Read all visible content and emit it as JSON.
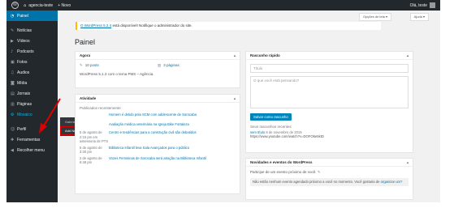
{
  "adminbar": {
    "site_name": "agencia-teste",
    "new_label": "+ Novo",
    "greeting": "Olá, teste"
  },
  "sidebar": {
    "items": [
      {
        "icon": "dashboard-icon",
        "glyph": "◔",
        "label": "Painel"
      },
      {
        "icon": "pin-icon",
        "glyph": "✎",
        "label": "Notícias"
      },
      {
        "icon": "video-icon",
        "glyph": "▶",
        "label": "Vídeos"
      },
      {
        "icon": "podcast-icon",
        "glyph": "♪",
        "label": "Podcasts"
      },
      {
        "icon": "photo-icon",
        "glyph": "▣",
        "label": "Fotos"
      },
      {
        "icon": "audio-icon",
        "glyph": "♫",
        "label": "Audios"
      },
      {
        "icon": "media-icon",
        "glyph": "◙",
        "label": "Mídia"
      },
      {
        "icon": "journal-icon",
        "glyph": "▤",
        "label": "Jornais"
      },
      {
        "icon": "pages-icon",
        "glyph": "▥",
        "label": "Páginas"
      },
      {
        "icon": "gallery-icon",
        "glyph": "⚙",
        "label": "Mosaico"
      },
      {
        "icon": "profile-icon",
        "glyph": "☺",
        "label": "Perfil"
      },
      {
        "icon": "tools-icon",
        "glyph": "✚",
        "label": "Ferramentas"
      },
      {
        "icon": "collapse-icon",
        "glyph": "◀",
        "label": "Recolher menu"
      }
    ],
    "submenu": [
      "Galerias",
      "Add New"
    ]
  },
  "header": {
    "screen_options": "Opções de tela ▾",
    "help": "Ajuda ▾"
  },
  "notice": {
    "link": "O WordPress 5.2.4",
    "text": " está disponível! Notifique o administrador do site."
  },
  "page_title": "Painel",
  "glance": {
    "title": "Agora",
    "posts": "10 posts",
    "pages": "3 páginas",
    "version": "WordPress 5.1.3 com o tema PMS – Agência."
  },
  "activity": {
    "title": "Atividade",
    "recent_label": "Publicados recentemente",
    "rows": [
      {
        "date": "",
        "title": "Homem é detido pela SCM com adolescente de Sorocaba"
      },
      {
        "date": "",
        "title": "Avaliação médica veterinária na Igreja Bike Fortaleza"
      },
      {
        "date": "5 de agosto de 2:15 pm em assessoria de PTS",
        "title": "Centro e tendências para a construção civil são debatidos"
      },
      {
        "date": "5 de agosto de 3:30 pm",
        "title": "Biblioteca Infantil leva Sala Avançados para o público"
      },
      {
        "date": "2 de agosto de 6:48 pm",
        "title": "Vozes Femininas de Sorocaba será atração na Biblioteca Infantil"
      }
    ]
  },
  "quickdraft": {
    "title": "Rascunho rápido",
    "title_placeholder": "Título",
    "content_placeholder": "O que você está pensando?",
    "save_label": "Salvar como rascunho",
    "recent_label": "Seus rascunhos recentes",
    "draft_title": "sem título",
    "draft_date": "8 de novembro de 2019",
    "draft_excerpt": "https://www.youtube.com/watch?v=DOFO6e5ktD"
  },
  "events": {
    "title": "Novidades e eventos do WordPress",
    "intro": "Participe de um evento próximo de você.",
    "none_text": "Não estão nenhum evento agendado próximo a você no momento. Você gostaria de ",
    "none_link": "organizar um?"
  },
  "colors": {
    "admin_bar": "#23282d",
    "active_menu": "#0073aa",
    "highlight": "#dd0000"
  }
}
